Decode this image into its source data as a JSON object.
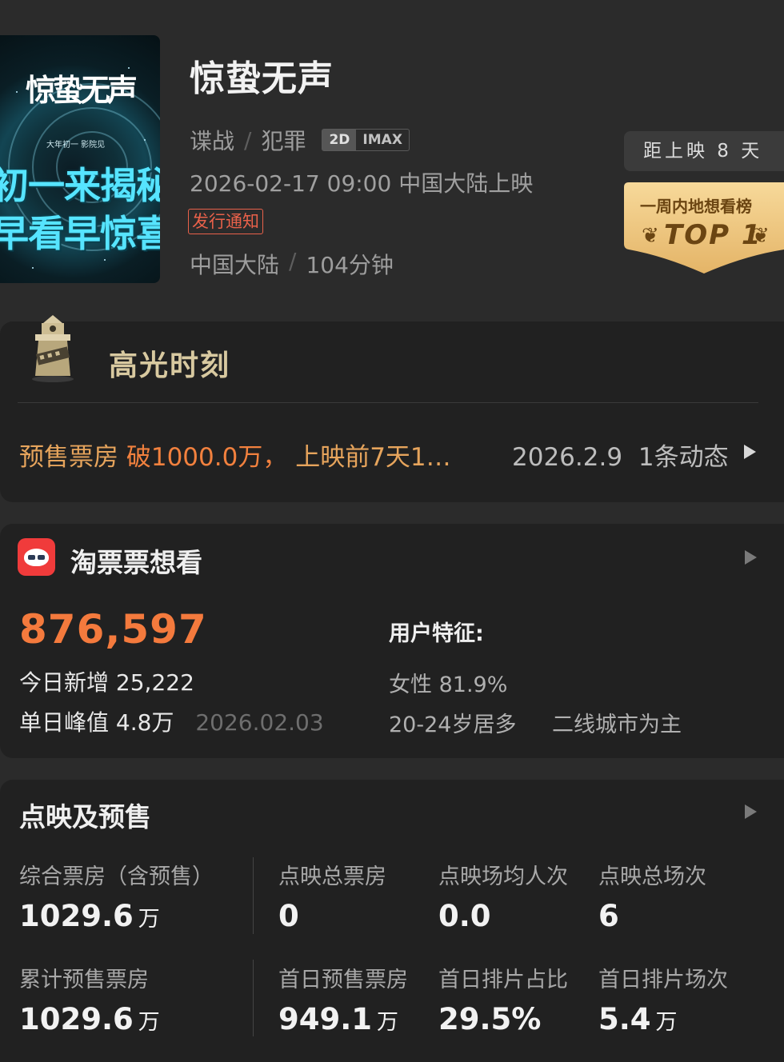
{
  "movie": {
    "poster_title": "惊蛰无声",
    "poster_subtitle": "大年初一 影院见",
    "poster_line1": "初一来揭秘",
    "poster_line2": "早看早惊喜",
    "title": "惊蛰无声",
    "genres": [
      "谍战",
      "犯罪"
    ],
    "formats": [
      "2D",
      "IMAX"
    ],
    "release": "2026-02-17 09:00 中国大陆上映",
    "notice_tag": "发行通知",
    "region": "中国大陆",
    "duration": "104分钟",
    "countdown": "距上映 8 天",
    "rank_badge_title": "一周内地想看榜",
    "rank_badge_value": "TOP 1"
  },
  "highlights": {
    "title": "高光时刻",
    "text_prefix": "预售票房",
    "text_hot": "破1000.0万，",
    "text_rest": "上映前7天1…",
    "date": "2026.2.9",
    "count": "1条动态"
  },
  "taopiao": {
    "title": "淘票票想看",
    "want_count": "876,597",
    "today_label": "今日新增",
    "today_value": "25,222",
    "peak_label": "单日峰值",
    "peak_value": "4.8万",
    "peak_date": "2026.02.03",
    "features_label": "用户特征:",
    "feature_gender": "女性 81.9%",
    "feature_age": "20-24岁居多",
    "feature_city": "二线城市为主"
  },
  "presale": {
    "title": "点映及预售",
    "stats": [
      {
        "label": "综合票房（含预售）",
        "value": "1029.6",
        "unit": "万"
      },
      {
        "label": "点映总票房",
        "value": "0",
        "unit": ""
      },
      {
        "label": "点映场均人次",
        "value": "0.0",
        "unit": ""
      },
      {
        "label": "点映总场次",
        "value": "6",
        "unit": ""
      },
      {
        "label": "累计预售票房",
        "value": "1029.6",
        "unit": "万"
      },
      {
        "label": "首日预售票房",
        "value": "949.1",
        "unit": "万"
      },
      {
        "label": "首日排片占比",
        "value": "29.5%",
        "unit": ""
      },
      {
        "label": "首日排片场次",
        "value": "5.4",
        "unit": "万"
      }
    ]
  }
}
